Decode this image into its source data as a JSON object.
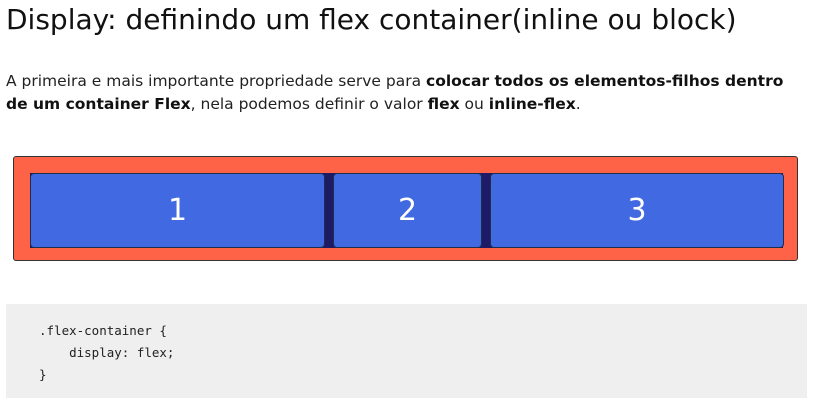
{
  "header": {
    "title": "Display: definindo um flex container(inline ou block)"
  },
  "intro": {
    "part1": "A primeira e mais importante propriedade serve para ",
    "bold1": "colocar todos os elementos-filhos dentro de um container Flex",
    "part2": ", nela podemos definir o valor ",
    "bold2": "flex",
    "part3": " ou ",
    "bold3": "inline-flex",
    "part4": "."
  },
  "demo": {
    "items": [
      {
        "label": "1"
      },
      {
        "label": "2"
      },
      {
        "label": "3"
      }
    ],
    "container_color": "#ff6347",
    "item_color": "#4169e1",
    "gap_color": "#1e1a66"
  },
  "code": {
    "lines": [
      ".flex-container {",
      "    display: flex;",
      "}"
    ]
  }
}
